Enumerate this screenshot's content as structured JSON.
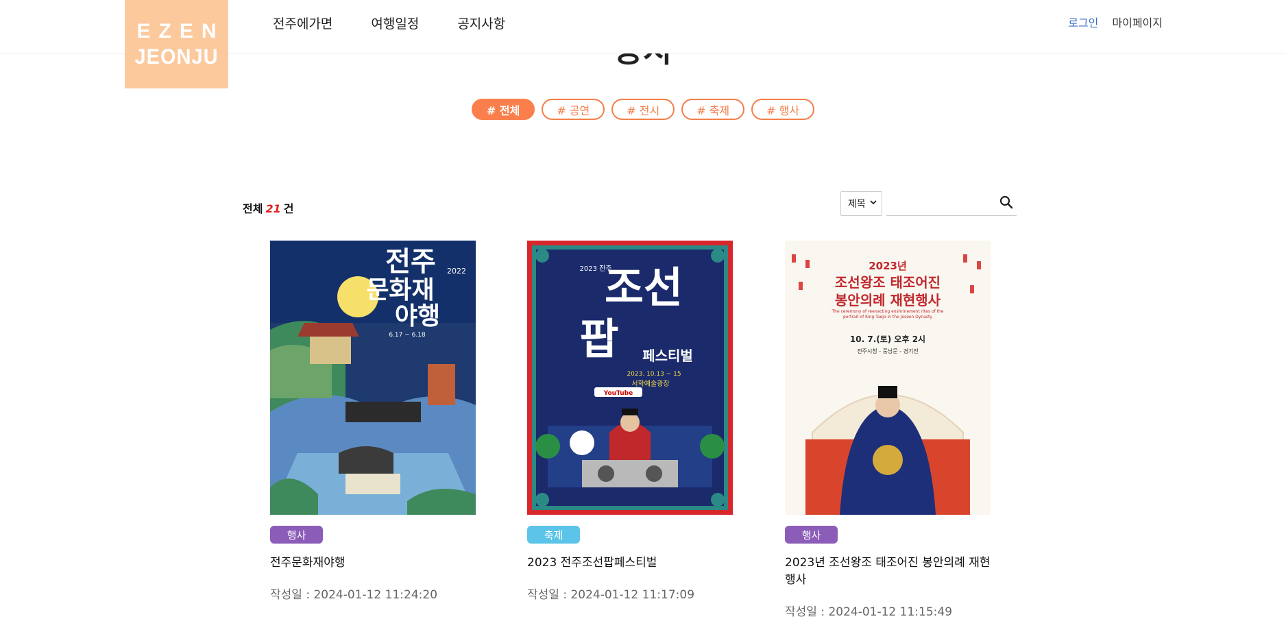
{
  "logo": {
    "line1": "EZEN",
    "line2": "JEONJU",
    "bg": "#fcc99d"
  },
  "nav": {
    "items": [
      "전주에가면",
      "여행일정",
      "공지사항"
    ]
  },
  "util": {
    "login": "로그인",
    "mypage": "마이페이지"
  },
  "page": {
    "heading": "공지"
  },
  "tags": [
    "# 전체",
    "# 공연",
    "# 전시",
    "# 축제",
    "# 행사"
  ],
  "count": {
    "prefix": "전체",
    "value": "21",
    "suffix": "건"
  },
  "search": {
    "option": "제목",
    "value": ""
  },
  "colors": {
    "accent": "#fa7f4c",
    "badge_event": "#8b5cb8",
    "badge_festival": "#5bc4e8"
  },
  "cards": [
    {
      "category": "행사",
      "title": "전주문화재야행",
      "date": "작성일 : 2024-01-12 11:24:20",
      "poster": {
        "title_lines": [
          "전주",
          "문화재",
          "야행"
        ],
        "year": "2022",
        "dates": "6.17 ~ 6.18"
      }
    },
    {
      "category": "축제",
      "title": "2023 전주조선팝페스티벌",
      "date": "작성일 : 2024-01-12 11:17:09",
      "poster": {
        "title_big": "조선",
        "title_big2": "팝",
        "sub": "페스티벌",
        "year": "2023 전주",
        "dates": "2023. 10.13 ~ 15",
        "place": "서학예술광장",
        "yt": "YouTube"
      }
    },
    {
      "category": "행사",
      "title": "2023년 조선왕조 태조어진 봉안의례 재현행사",
      "date": "작성일 : 2024-01-12 11:15:49",
      "poster": {
        "year": "2023년",
        "title_lines": [
          "조선왕조 태조어진",
          "봉안의례 재현행사"
        ],
        "eng": "The ceremony of reenacting enshrinement rites of the portrait of King Taejo in the Joseon Dynasty",
        "dates": "10. 7.(토) 오후 2시",
        "place": "전주시청 - 풍남문 - 경기전"
      }
    }
  ]
}
